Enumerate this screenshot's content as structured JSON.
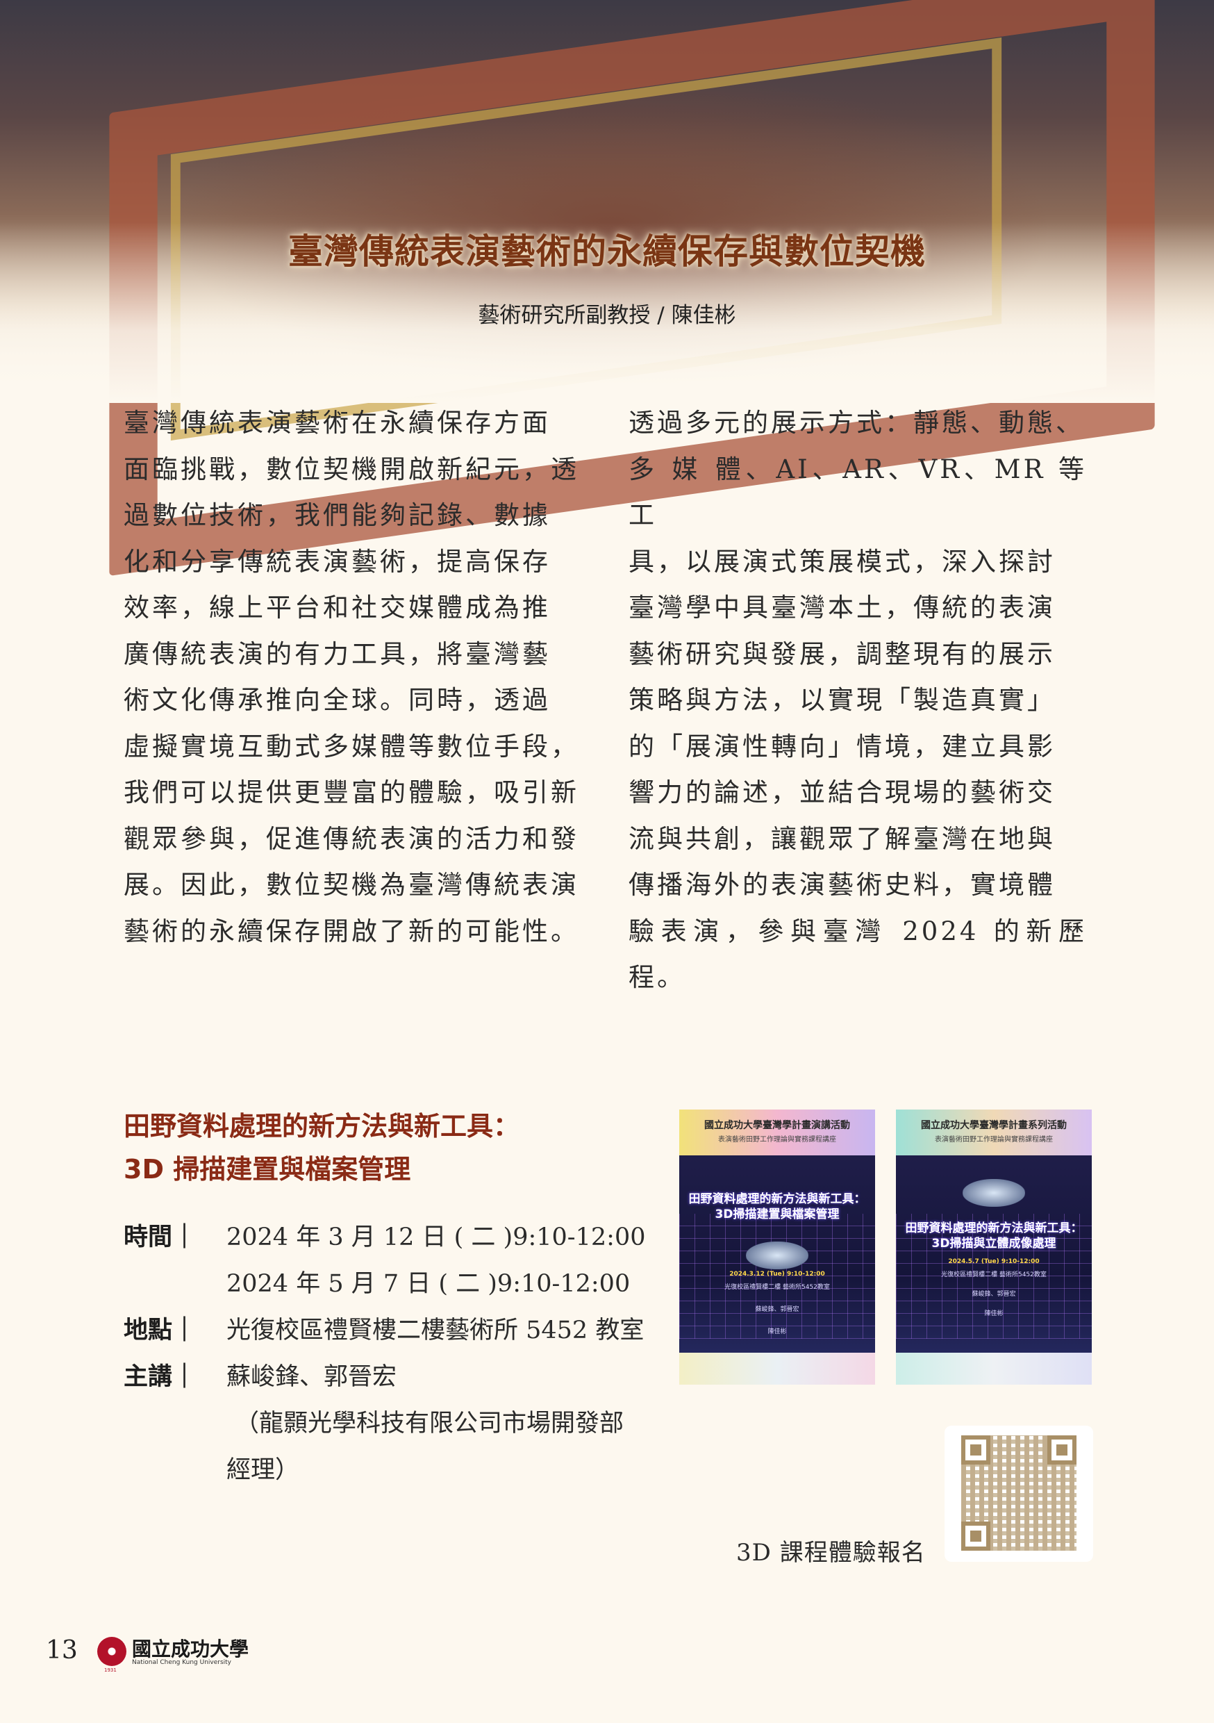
{
  "header": {
    "title": "臺灣傳統表演藝術的永續保存與數位契機",
    "author": "藝術研究所副教授 / 陳佳彬"
  },
  "article": {
    "left_lines": [
      "臺灣傳統表演藝術在永續保存方面",
      "面臨挑戰，數位契機開啟新紀元，透",
      "過數位技術，我們能夠記錄、數據",
      "化和分享傳統表演藝術，提高保存",
      "效率，線上平台和社交媒體成為推",
      "廣傳統表演的有力工具，將臺灣藝",
      "術文化傳承推向全球。同時，透過",
      "虛擬實境互動式多媒體等數位手段，",
      "我們可以提供更豐富的體驗，吸引新",
      "觀眾參與，促進傳統表演的活力和發",
      "展。因此，數位契機為臺灣傳統表演",
      "藝術的永續保存開啟了新的可能性。"
    ],
    "right_lines": [
      "透過多元的展示方式：靜態、動態、",
      "多 媒 體、AI、AR、VR、MR 等 工",
      "具，以展演式策展模式，深入探討",
      "臺灣學中具臺灣本土，傳統的表演",
      "藝術研究與發展，調整現有的展示",
      "策略與方法，以實現「製造真實」",
      "的「展演性轉向」情境，建立具影",
      "響力的論述，並結合現場的藝術交",
      "流與共創，讓觀眾了解臺灣在地與",
      "傳播海外的表演藝術史料，實境體",
      "驗表演，參與臺灣 2024 的新歷程。"
    ]
  },
  "event": {
    "title_line1": "田野資料處理的新方法與新工具：",
    "title_line2": "3D 掃描建置與檔案管理",
    "time_label": "時間｜",
    "time_1": "2024 年 3 月 12 日 ( 二 )9:10-12:00",
    "time_2": "2024 年 5 月 7 日 ( 二 )9:10-12:00",
    "place_label": "地點｜",
    "place": "光復校區禮賢樓二樓藝術所 5452 教室",
    "speaker_label": "主講｜",
    "speaker": "蘇峻鋒、郭晉宏",
    "speaker_org_1": "（龍顥光學科技有限公司市場開發部",
    "speaker_org_2": "經理）"
  },
  "posters": [
    {
      "head_title": "國立成功大學臺灣學計畫演講活動",
      "head_sub": "表演藝術田野工作理論與實務課程講座",
      "body_title_1": "田野資料處理的新方法與新工具：",
      "body_title_2": "3D掃描建置與檔案管理",
      "date": "2024.3.12 (Tue) 9:10-12:00",
      "place": "光復校區禮賢樓二樓 藝術所5452教室",
      "speakers": "蘇峻鋒、郭晉宏",
      "hosts": "陳佳彬"
    },
    {
      "head_title": "國立成功大學臺灣學計畫系列活動",
      "head_sub": "表演藝術田野工作理論與實務課程講座",
      "body_title_1": "田野資料處理的新方法與新工具：",
      "body_title_2": "3D掃描與立體成像處理",
      "date": "2024.5.7 (Tue) 9:10-12:00",
      "place": "光復校區禮賢樓二樓 藝術所5452教室",
      "speakers": "蘇峻鋒、郭晉宏",
      "hosts": "陳佳彬"
    }
  ],
  "qr": {
    "label": "3D 課程體驗報名"
  },
  "footer": {
    "page_number": "13",
    "university_cn": "國立成功大學",
    "university_en": "National Cheng Kung University",
    "founded": "1931"
  },
  "colors": {
    "title": "#7a3514",
    "event_title": "#8a2a15",
    "background": "#fdf8ef",
    "ncku_red": "#b3122a"
  }
}
